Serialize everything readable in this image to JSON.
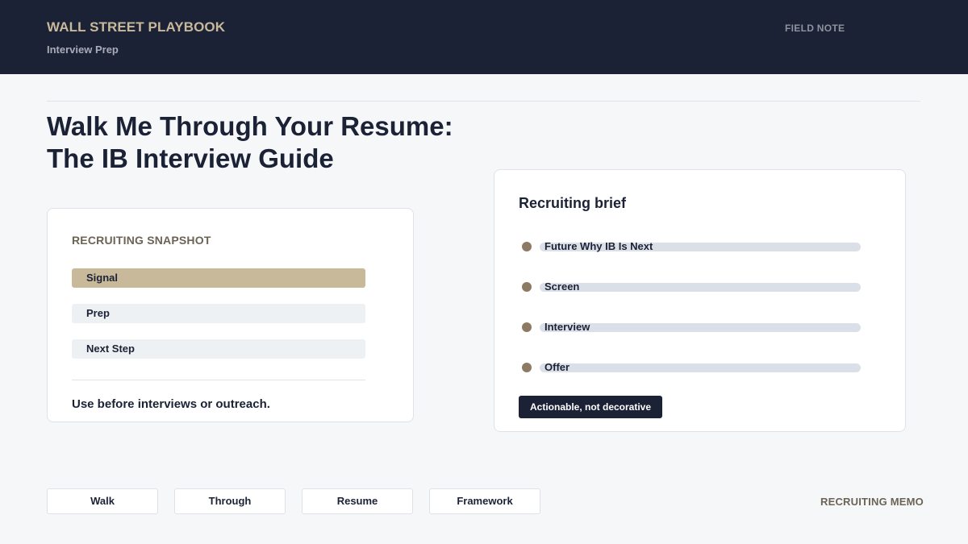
{
  "header": {
    "brand": "WALL STREET PLAYBOOK",
    "subtitle": "Interview Prep",
    "note": "FIELD NOTE"
  },
  "title": {
    "line1": "Walk Me Through Your Resume:",
    "line2": "The IB Interview Guide"
  },
  "snapshot": {
    "heading": "RECRUITING SNAPSHOT",
    "items": [
      {
        "label": "Signal",
        "active": true
      },
      {
        "label": "Prep",
        "active": false
      },
      {
        "label": "Next Step",
        "active": false
      }
    ],
    "footer": "Use before interviews or outreach."
  },
  "brief": {
    "heading": "Recruiting brief",
    "items": [
      {
        "label": "Future Why IB Is Next"
      },
      {
        "label": "Screen"
      },
      {
        "label": "Interview"
      },
      {
        "label": "Offer"
      }
    ],
    "tag": "Actionable, not decorative"
  },
  "chips": [
    {
      "label": "Walk"
    },
    {
      "label": "Through"
    },
    {
      "label": "Resume"
    },
    {
      "label": "Framework"
    }
  ],
  "footer": {
    "memo": "RECRUITING MEMO"
  },
  "colors": {
    "navy": "#1b2236",
    "gold": "#c9b99b",
    "bullet": "#8c7b62",
    "background": "#f6f7f9"
  }
}
